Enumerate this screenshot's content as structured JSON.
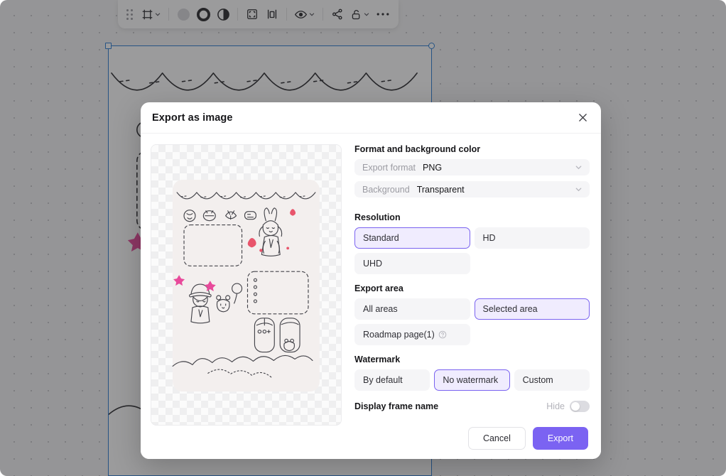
{
  "toolbar": {
    "items": [
      {
        "name": "drag-handle",
        "icon": "grip-dots"
      },
      {
        "name": "frame-tool",
        "icon": "frame-icon",
        "has_chevron": true
      },
      {
        "name": "fill-color",
        "icon": "filled-circle-icon"
      },
      {
        "name": "stroke-color",
        "icon": "ring-icon"
      },
      {
        "name": "opacity",
        "icon": "half-circle-icon"
      },
      {
        "name": "fit-to-selection",
        "icon": "fit-frame-icon"
      },
      {
        "name": "distribute",
        "icon": "distribute-icon"
      },
      {
        "name": "visibility",
        "icon": "eye-icon",
        "has_chevron": true
      },
      {
        "name": "share-nodes",
        "icon": "share-nodes-icon"
      },
      {
        "name": "lock",
        "icon": "unlock-icon",
        "has_chevron": true
      },
      {
        "name": "more-options",
        "icon": "ellipsis-icon"
      }
    ]
  },
  "dialog": {
    "title": "Export as image",
    "close_label": "✕",
    "preview": {
      "name": "export-preview",
      "background": "transparent-checkerboard"
    },
    "format_section": {
      "heading": "Format and background color",
      "fields": [
        {
          "label": "Export format",
          "value": "PNG",
          "name": "export-format-select"
        },
        {
          "label": "Background",
          "value": "Transparent",
          "name": "background-select"
        }
      ]
    },
    "resolution_section": {
      "heading": "Resolution",
      "options": [
        {
          "label": "Standard",
          "selected": true
        },
        {
          "label": "HD",
          "selected": false
        },
        {
          "label": "UHD",
          "selected": false
        }
      ]
    },
    "export_area_section": {
      "heading": "Export area",
      "options": [
        {
          "label": "All areas",
          "selected": false,
          "help": false
        },
        {
          "label": "Selected area",
          "selected": true,
          "help": false
        },
        {
          "label": "Roadmap page(1)",
          "selected": false,
          "help": true
        }
      ]
    },
    "watermark_section": {
      "heading": "Watermark",
      "options": [
        {
          "label": "By default",
          "selected": false
        },
        {
          "label": "No watermark",
          "selected": true
        },
        {
          "label": "Custom",
          "selected": false
        }
      ]
    },
    "frame_name_row": {
      "label": "Display frame name",
      "toggle_label": "Hide",
      "toggle_on": false
    },
    "footer": {
      "cancel_label": "Cancel",
      "export_label": "Export"
    }
  },
  "colors": {
    "accent": "#7b63f2",
    "accent_soft_bg": "#f0ecfe",
    "field_bg": "#f5f5f7",
    "selection_blue": "#2b7cd3",
    "overlay": "rgba(33,33,36,.45)"
  }
}
